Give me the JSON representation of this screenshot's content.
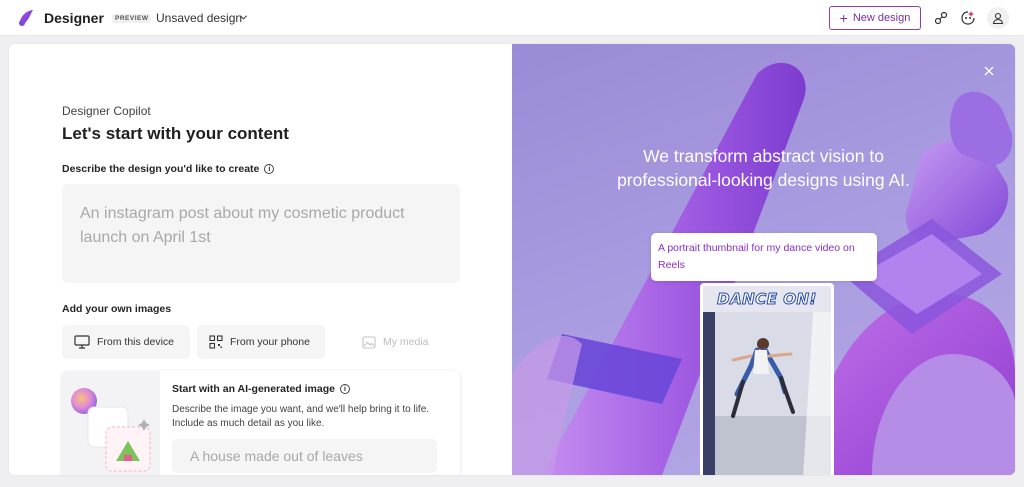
{
  "header": {
    "brand": "Designer",
    "badge": "PREVIEW",
    "doc_name": "Unsaved design",
    "new_design_label": "New design",
    "icons": [
      "designer-logo-icon",
      "chevron-down-icon",
      "plus-icon",
      "share-icon",
      "copilot-icon",
      "profile-icon"
    ]
  },
  "main": {
    "copilot_label": "Designer Copilot",
    "heading": "Let's start with your content",
    "describe_label": "Describe the design you'd like to create",
    "prompt_placeholder": "An instagram post about my cosmetic product launch on April 1st",
    "add_images_label": "Add your own images",
    "sources": [
      {
        "label": "From this device",
        "icon": "monitor-icon"
      },
      {
        "label": "From your phone",
        "icon": "qr-code-icon"
      },
      {
        "label": "My media",
        "icon": "image-icon"
      }
    ],
    "ai_card": {
      "title": "Start with an AI-generated image",
      "description": "Describe the image you want, and we'll help bring it to life. Include as much detail as you like.",
      "placeholder": "A house made out of leaves"
    }
  },
  "promo": {
    "tagline": "We transform abstract vision to professional-looking designs using AI.",
    "example_prompt": "A portrait thumbnail for my dance video on Reels",
    "preview_title": "DANCE ON!"
  },
  "colors": {
    "accent": "#7a2ea3",
    "promo_bg": "#a89be0",
    "bubble_text": "#8a2ec4"
  }
}
